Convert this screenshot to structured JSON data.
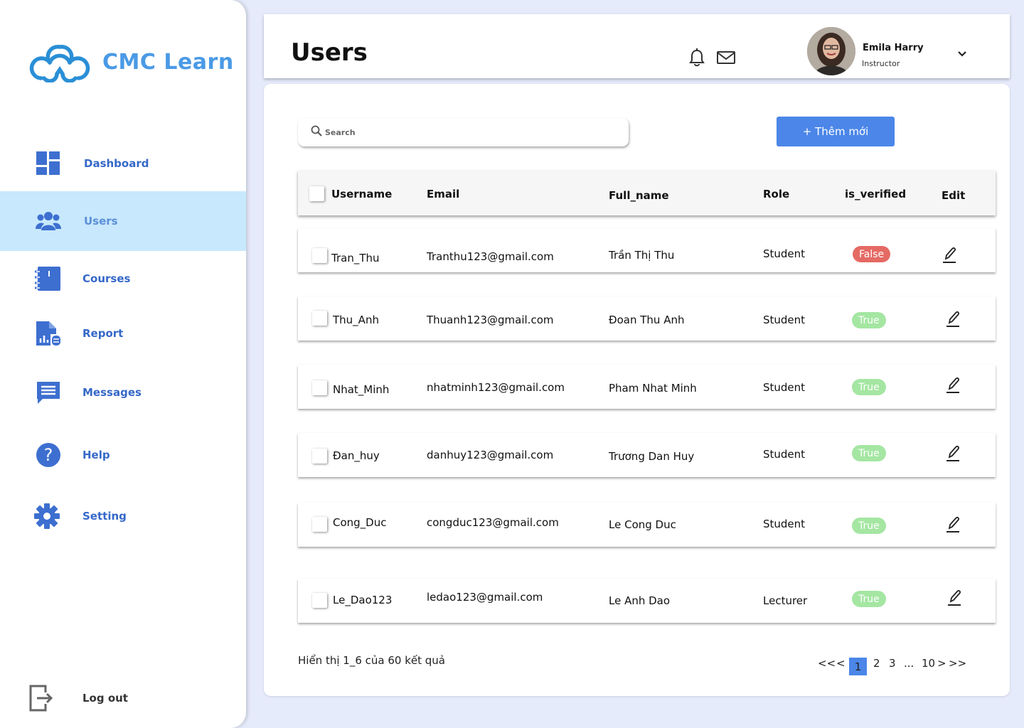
{
  "brand": {
    "name": "CMC Learn",
    "color": "#4a9ae6"
  },
  "sidebar": {
    "items": [
      {
        "label": "Dashboard",
        "icon": "dashboard-icon"
      },
      {
        "label": "Users",
        "icon": "users-icon",
        "active": true
      },
      {
        "label": "Courses",
        "icon": "courses-icon"
      },
      {
        "label": "Report",
        "icon": "report-icon"
      },
      {
        "label": "Messages",
        "icon": "messages-icon"
      },
      {
        "label": "Help",
        "icon": "help-icon"
      },
      {
        "label": "Setting",
        "icon": "gear-icon"
      }
    ],
    "logout": "Log out"
  },
  "header": {
    "title": "Users",
    "user": {
      "name": "Emila Harry",
      "role": "Instructor"
    }
  },
  "toolbar": {
    "search_placeholder": "Search",
    "add_label": "+ Thêm mới"
  },
  "table": {
    "columns": [
      "Username",
      "Email",
      "Full_name",
      "Role",
      "is_verified",
      "Edit"
    ],
    "rows": [
      {
        "username": "Tran_Thu",
        "email": "Tranthu123@gmail.com",
        "full_name": "Trần Thị Thu",
        "role": "Student",
        "verified": "False"
      },
      {
        "username": "Thu_Anh",
        "email": "Thuanh123@gmail.com",
        "full_name": "Đoan Thu Anh",
        "role": "Student",
        "verified": "True"
      },
      {
        "username": "Nhat_Minh",
        "email": "nhatminh123@gmail.com",
        "full_name": "Pham Nhat Minh",
        "role": "Student",
        "verified": "True"
      },
      {
        "username": "Đan_huy",
        "email": "danhuy123@gmail.com",
        "full_name": "Trương Dan Huy",
        "role": "Student",
        "verified": "True"
      },
      {
        "username": "Cong_Duc",
        "email": "congduc123@gmail.com",
        "full_name": "Le Cong Duc",
        "role": "Student",
        "verified": "True"
      },
      {
        "username": "Le_Dao123",
        "email": "ledao123@gmail.com",
        "full_name": "Le Anh Dao",
        "role": "Lecturer",
        "verified": "True"
      }
    ]
  },
  "footer": {
    "summary": "Hiển thị 1_6 của 60 kết quả",
    "pagination": {
      "first": "<<",
      "prev": "<",
      "pages": [
        "1",
        "2",
        "3"
      ],
      "ellipsis": "...",
      "last_page": "10",
      "next": ">",
      "last": ">>",
      "current": "1"
    }
  },
  "colors": {
    "accent": "#4b86e8",
    "active_nav": "#c8e8fd",
    "badge_false": "#e56a64",
    "badge_true": "#a4e6a2",
    "background": "#e6ebfb"
  }
}
